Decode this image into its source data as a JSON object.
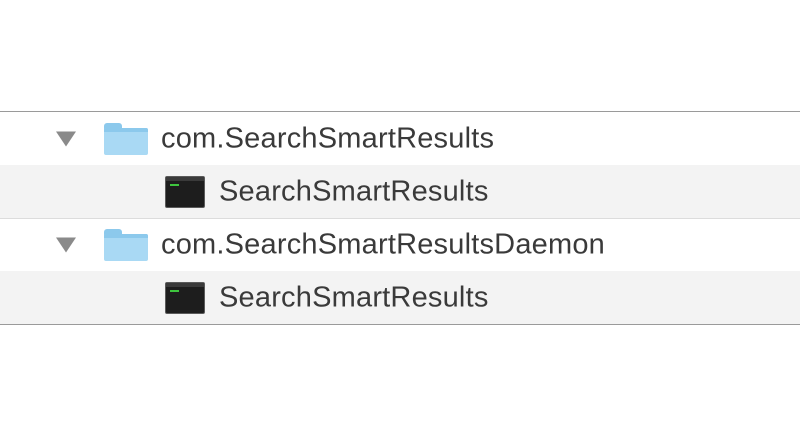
{
  "file_list": {
    "items": [
      {
        "kind": "folder",
        "icon": "folder-icon",
        "disclosure": "expanded",
        "name": "com.SearchSmartResults",
        "children": [
          {
            "kind": "executable",
            "icon": "terminal-executable-icon",
            "name": "SearchSmartResults"
          }
        ]
      },
      {
        "kind": "folder",
        "icon": "folder-icon",
        "disclosure": "expanded",
        "name": "com.SearchSmartResultsDaemon",
        "children": [
          {
            "kind": "executable",
            "icon": "terminal-executable-icon",
            "name": "SearchSmartResults"
          }
        ]
      }
    ]
  },
  "colors": {
    "folder": "#a9d9f4",
    "row_alt": "#f3f3f3",
    "text": "#3a3a3a",
    "disclosure": "#8a8a8a"
  }
}
